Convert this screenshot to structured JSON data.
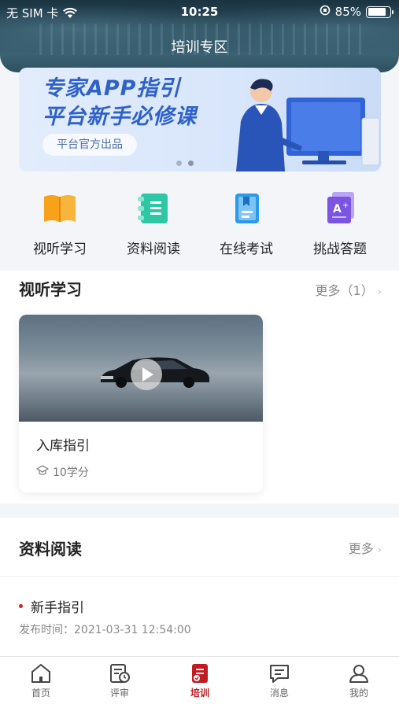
{
  "status_bar": {
    "carrier": "无 SIM 卡",
    "time": "10:25",
    "battery": "85%",
    "battery_level": 0.85
  },
  "nav": {
    "title": "培训专区"
  },
  "banner": {
    "line1": "专家APP指引",
    "line2": "平台新手必修课",
    "badge": "平台官方出品",
    "slide_count": 2,
    "active_slide": 2
  },
  "menu": [
    {
      "label": "视听学习",
      "icon": "book-icon"
    },
    {
      "label": "资料阅读",
      "icon": "document-list-icon"
    },
    {
      "label": "在线考试",
      "icon": "exam-icon"
    },
    {
      "label": "挑战答题",
      "icon": "quiz-icon"
    }
  ],
  "av_section": {
    "title": "视听学习",
    "more": "更多（1）",
    "course": {
      "title": "入库指引",
      "credits": "10学分"
    }
  },
  "reading_section": {
    "title": "资料阅读",
    "more": "更多",
    "item": {
      "title": "新手指引",
      "time": "发布时间：2021-03-31 12:54:00"
    }
  },
  "tabs": [
    {
      "label": "首页",
      "icon": "home-icon"
    },
    {
      "label": "评审",
      "icon": "review-icon"
    },
    {
      "label": "培训",
      "icon": "training-icon",
      "active": true
    },
    {
      "label": "消息",
      "icon": "message-icon"
    },
    {
      "label": "我的",
      "icon": "profile-icon"
    }
  ],
  "colors": {
    "accent_red": "#c01b22",
    "banner_blue": "#2e62c9"
  }
}
